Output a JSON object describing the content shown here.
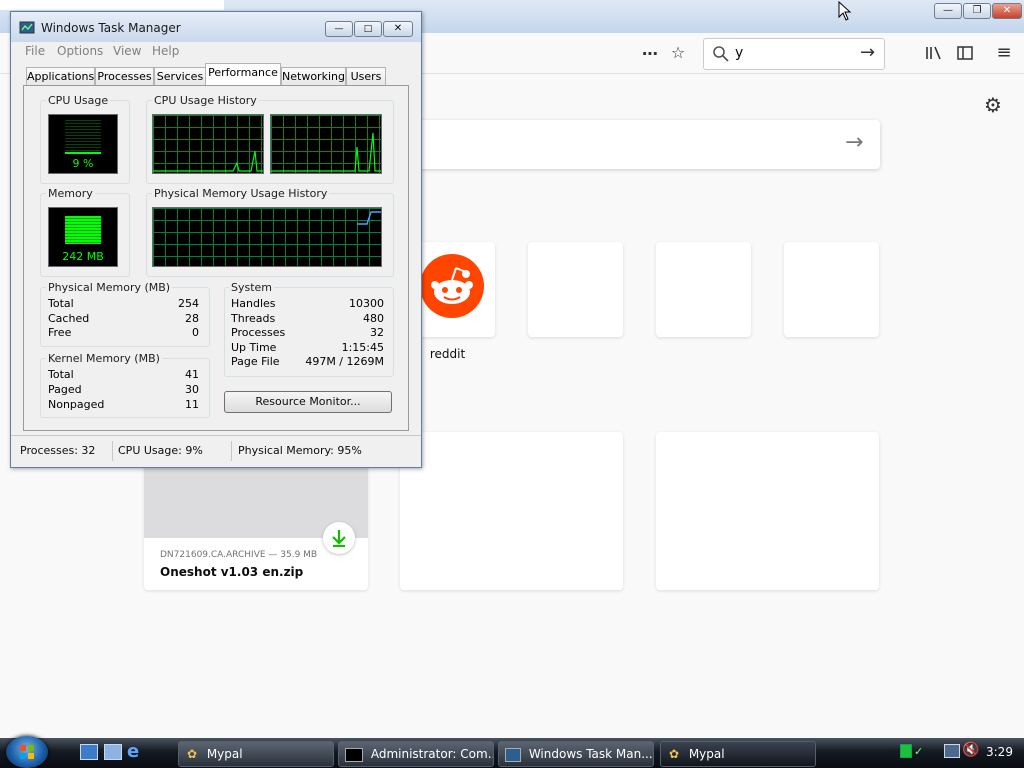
{
  "browser": {
    "search_value": "y",
    "reddit_label": "reddit",
    "download": {
      "meta": "DN721609.CA.ARCHIVE — 35.9 MB",
      "name": "Oneshot v1.03 en.zip"
    }
  },
  "task_manager": {
    "title": "Windows Task Manager",
    "menu": [
      "File",
      "Options",
      "View",
      "Help"
    ],
    "tabs": [
      "Applications",
      "Processes",
      "Services",
      "Performance",
      "Networking",
      "Users"
    ],
    "active_tab": "Performance",
    "cpu_usage_label": "CPU Usage",
    "cpu_usage_value": "9 %",
    "cpu_history_label": "CPU Usage History",
    "memory_label": "Memory",
    "memory_value": "242 MB",
    "memory_history_label": "Physical Memory Usage History",
    "physical_memory": {
      "title": "Physical Memory (MB)",
      "rows": [
        {
          "label": "Total",
          "value": "254"
        },
        {
          "label": "Cached",
          "value": "28"
        },
        {
          "label": "Free",
          "value": "0"
        }
      ]
    },
    "kernel_memory": {
      "title": "Kernel Memory (MB)",
      "rows": [
        {
          "label": "Total",
          "value": "41"
        },
        {
          "label": "Paged",
          "value": "30"
        },
        {
          "label": "Nonpaged",
          "value": "11"
        }
      ]
    },
    "system": {
      "title": "System",
      "rows": [
        {
          "label": "Handles",
          "value": "10300"
        },
        {
          "label": "Threads",
          "value": "480"
        },
        {
          "label": "Processes",
          "value": "32"
        },
        {
          "label": "Up Time",
          "value": "1:15:45"
        },
        {
          "label": "Page File",
          "value": "497M / 1269M"
        }
      ]
    },
    "resource_monitor_button": "Resource Monitor...",
    "status": {
      "processes": "Processes: 32",
      "cpu": "CPU Usage: 9%",
      "memory": "Physical Memory: 95%"
    }
  },
  "taskbar": {
    "buttons": [
      {
        "label": "Mypal",
        "icon": "mypal-icon"
      },
      {
        "label": "Administrator: Com...",
        "icon": "cmd-icon"
      },
      {
        "label": "Windows Task Man...",
        "icon": "taskmanager-icon"
      },
      {
        "label": "Mypal",
        "icon": "mypal-icon"
      }
    ],
    "clock": "3:29"
  },
  "colors": {
    "reddit": "#ff4500",
    "graph_line": "#00ff00",
    "download_green": "#12bc00"
  }
}
